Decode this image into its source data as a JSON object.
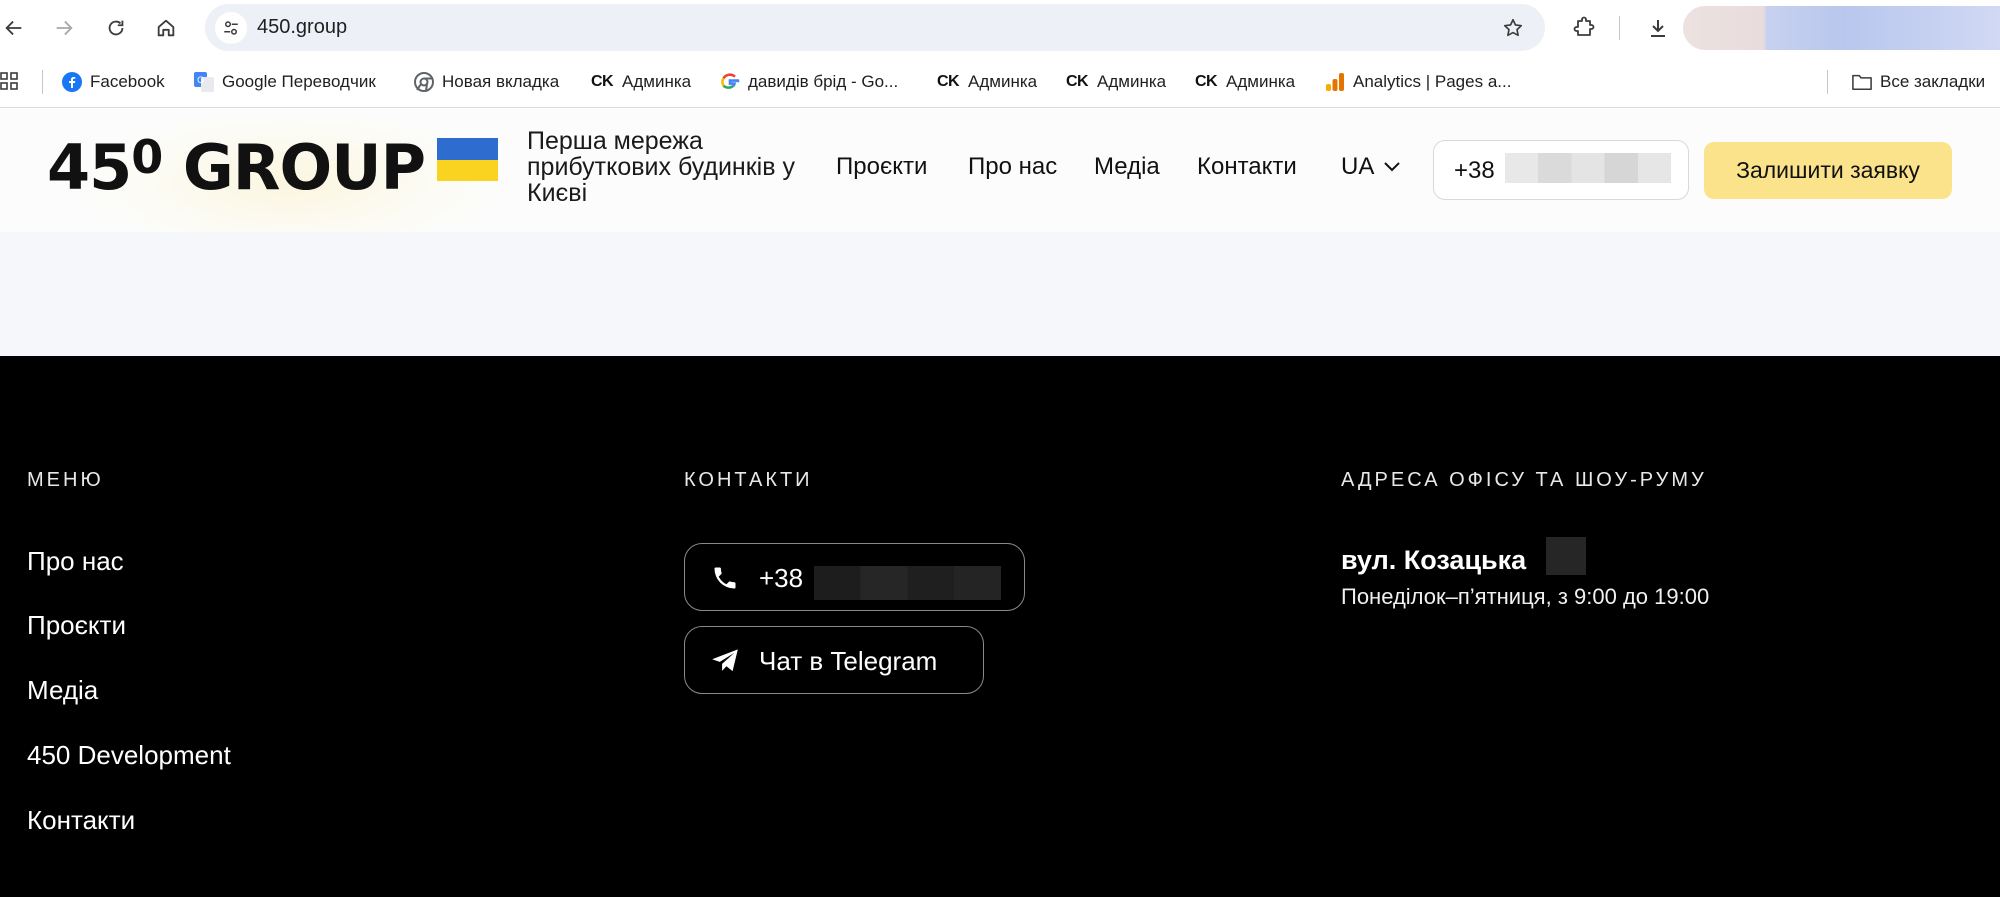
{
  "browser": {
    "url": "450.group",
    "nav": {
      "back": "arrow-left-icon",
      "forward": "arrow-right-icon",
      "reload": "reload-icon",
      "home": "home-icon"
    }
  },
  "bookmarks": [
    {
      "label": "Facebook",
      "icon": "facebook-icon"
    },
    {
      "label": "Google Переводчик",
      "icon": "google-translate-icon"
    },
    {
      "label": "Новая вкладка",
      "icon": "chrome-icon"
    },
    {
      "label": "Админка",
      "icon": "ck-icon",
      "icon_text": "CK"
    },
    {
      "label": "давидів брід - Go...",
      "icon": "google-icon"
    },
    {
      "label": "Админка",
      "icon": "ck-icon",
      "icon_text": "CK"
    },
    {
      "label": "Админка",
      "icon": "ck-icon",
      "icon_text": "CK"
    },
    {
      "label": "Админка",
      "icon": "ck-icon",
      "icon_text": "CK"
    },
    {
      "label": "Analytics | Pages a...",
      "icon": "analytics-icon"
    }
  ],
  "all_bookmarks": "Все закладки",
  "site": {
    "logo_text": "45",
    "logo_sup": "0",
    "logo_group": " GROUP",
    "tagline": "Перша мережа прибуткових будинків у Києві",
    "nav": [
      "Проєкти",
      "Про нас",
      "Медіа",
      "Контакти"
    ],
    "lang": "UA",
    "phone_prefix": "+38",
    "cta": "Залишити заявку"
  },
  "footer": {
    "menu_heading": "МЕНЮ",
    "menu_items": [
      "Про нас",
      "Проєкти",
      "Медіа",
      "450 Development",
      "Контакти"
    ],
    "contacts_heading": "КОНТАКТИ",
    "phone_prefix": "+38",
    "telegram": "Чат в Telegram",
    "address_heading": "АДРЕСА ОФІСУ ТА ШОУ-РУМУ",
    "address": "вул. Козацька",
    "hours": "Понеділок–п’ятниця, з 9:00 до 19:00"
  },
  "colors": {
    "cta_bg": "#fbe38c",
    "flag_blue": "#2f6cd0",
    "flag_yellow": "#f9d320",
    "footer_bg": "#000000",
    "band_bg": "#f6f7fb"
  }
}
